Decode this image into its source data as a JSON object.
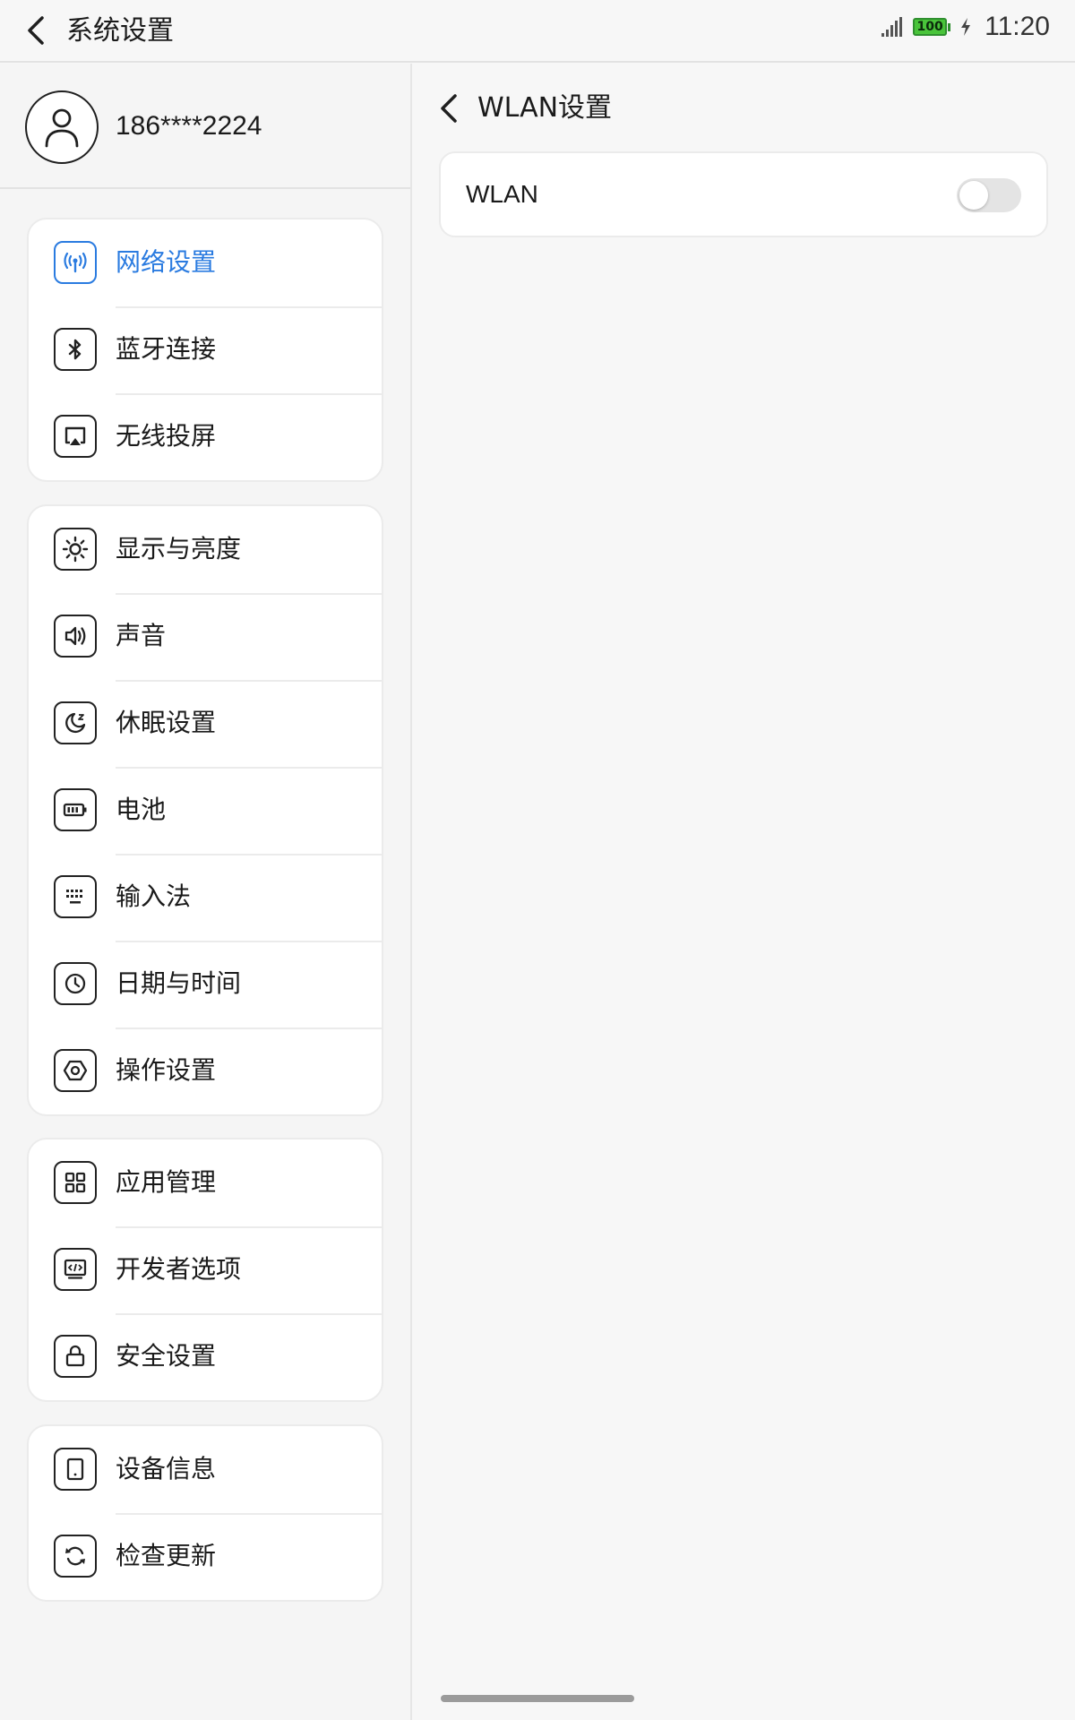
{
  "header": {
    "title": "系统设置",
    "back_icon": "chevron-left-icon"
  },
  "status_bar": {
    "signal_icon": "signal-icon",
    "battery_level": "100",
    "charging_icon": "charging-bolt-icon",
    "time": "11:20"
  },
  "profile": {
    "avatar_icon": "user-icon",
    "phone": "186****2224"
  },
  "sidebar": {
    "groups": [
      {
        "items": [
          {
            "label": "网络设置",
            "icon": "antenna-icon",
            "active": true
          },
          {
            "label": "蓝牙连接",
            "icon": "bluetooth-icon"
          },
          {
            "label": "无线投屏",
            "icon": "cast-screen-icon"
          }
        ]
      },
      {
        "items": [
          {
            "label": "显示与亮度",
            "icon": "brightness-icon"
          },
          {
            "label": "声音",
            "icon": "speaker-icon"
          },
          {
            "label": "休眠设置",
            "icon": "moon-sleep-icon"
          },
          {
            "label": "电池",
            "icon": "battery-icon"
          },
          {
            "label": "输入法",
            "icon": "keyboard-icon"
          },
          {
            "label": "日期与时间",
            "icon": "clock-icon"
          },
          {
            "label": "操作设置",
            "icon": "hexagon-icon"
          }
        ]
      },
      {
        "items": [
          {
            "label": "应用管理",
            "icon": "apps-grid-icon"
          },
          {
            "label": "开发者选项",
            "icon": "code-monitor-icon"
          },
          {
            "label": "安全设置",
            "icon": "lock-icon"
          }
        ]
      },
      {
        "items": [
          {
            "label": "设备信息",
            "icon": "tablet-icon"
          },
          {
            "label": "检查更新",
            "icon": "refresh-icon"
          }
        ]
      }
    ]
  },
  "detail": {
    "back_icon": "chevron-left-icon",
    "title": "WLAN设置",
    "wlan": {
      "label": "WLAN",
      "enabled": false
    }
  },
  "colors": {
    "accent": "#2a7be0",
    "background": "#f7f7f7",
    "card": "#ffffff"
  }
}
